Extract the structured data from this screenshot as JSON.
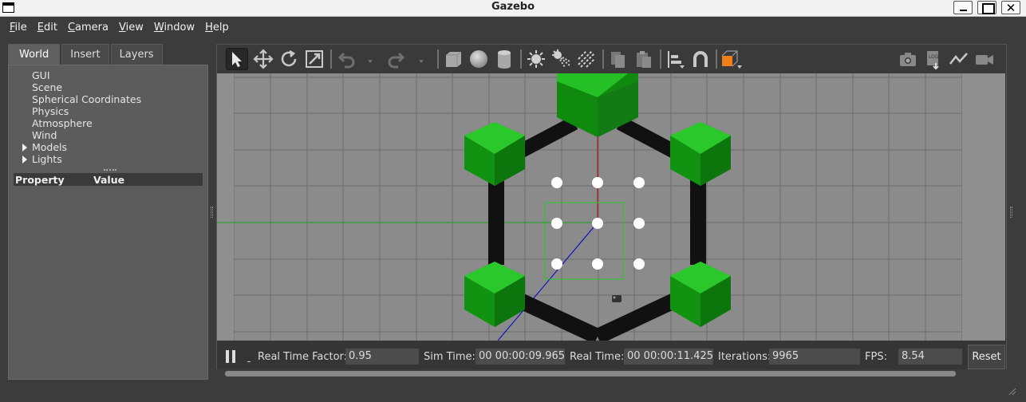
{
  "window": {
    "title": "Gazebo"
  },
  "menu": {
    "items": [
      {
        "underline": "F",
        "rest": "ile"
      },
      {
        "underline": "E",
        "rest": "dit"
      },
      {
        "underline": "C",
        "rest": "amera"
      },
      {
        "underline": "V",
        "rest": "iew"
      },
      {
        "underline": "W",
        "rest": "indow"
      },
      {
        "underline": "H",
        "rest": "elp"
      }
    ]
  },
  "left_panel": {
    "tabs": [
      "World",
      "Insert",
      "Layers"
    ],
    "active_tab": "World",
    "tree": [
      "GUI",
      "Scene",
      "Spherical Coordinates",
      "Physics",
      "Atmosphere",
      "Wind",
      "Models",
      "Lights"
    ],
    "property_header": {
      "property": "Property",
      "value": "Value"
    }
  },
  "toolbar": {
    "tools": [
      "select-arrow-icon",
      "translate-icon",
      "rotate-icon",
      "scale-icon",
      "undo-icon",
      "redo-icon",
      "box-icon",
      "sphere-icon",
      "cylinder-icon",
      "point-light-icon",
      "spot-light-icon",
      "directional-light-icon",
      "copy-icon",
      "paste-icon",
      "align-icon",
      "snap-magnet-icon",
      "view-angle-icon",
      "screenshot-camera-icon",
      "log-icon",
      "plot-icon",
      "record-video-icon"
    ],
    "active_tool": "select-arrow-icon"
  },
  "status_bar": {
    "real_time_factor_label": "Real Time Factor:",
    "real_time_factor": "0.95",
    "sim_time_label": "Sim Time:",
    "sim_time": "00 00:00:09.965",
    "real_time_label": "Real Time:",
    "real_time": "00 00:00:11.425",
    "iterations_label": "Iterations:",
    "iterations": "9965",
    "fps_label": "FPS:",
    "fps": "8.54",
    "reset_label": "Reset",
    "state": "paused-toggle"
  },
  "colors": {
    "background": "#3c3c3c",
    "grid_bg": "#8f8f8f",
    "cube_green": "#1ca51c",
    "link_black": "#111111",
    "x_axis": "#cc0000",
    "y_axis": "#00aa00",
    "z_axis": "#0000cc"
  }
}
